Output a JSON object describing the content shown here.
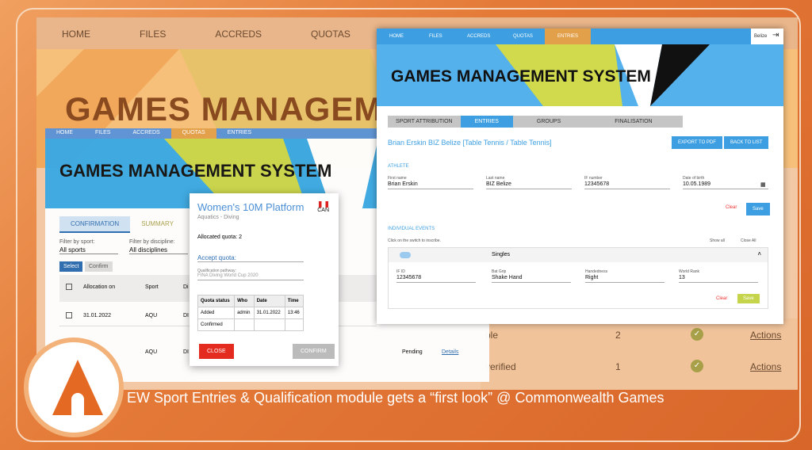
{
  "caption": "EW Sport Entries & Qualification module gets a “first look” @ Commonwealth Games",
  "win1": {
    "nav": [
      "HOME",
      "FILES",
      "ACCREDS",
      "QUOTAS"
    ],
    "title": "GAMES MANAGEMEN",
    "rows": [
      {
        "label": "ble",
        "count": "2",
        "action": "Actions"
      },
      {
        "label": "verified",
        "count": "1",
        "action": "Actions"
      }
    ]
  },
  "win2": {
    "nav": [
      "HOME",
      "FILES",
      "ACCREDS",
      "QUOTAS",
      "ENTRIES"
    ],
    "title": "GAMES MANAGEMENT SYSTEM",
    "tabs": [
      "CONFIRMATION",
      "SUMMARY"
    ],
    "filters": {
      "sport_label": "Filter by sport:",
      "sport_value": "All sports",
      "discipline_label": "Filter by discipline:",
      "discipline_value": "All disciplines"
    },
    "buttons": [
      "Select",
      "Confirm"
    ],
    "columns": [
      "Allocation on",
      "Sport",
      "Di"
    ],
    "rows": [
      {
        "date": "31.01.2022",
        "sport": "AQU",
        "code": "DI"
      },
      {
        "date": "",
        "sport": "AQU",
        "code": "DI",
        "status": "Pending",
        "link": "Details"
      }
    ]
  },
  "modal": {
    "title": "Women's 10M Platform",
    "subtitle": "Aquatics - Diving",
    "country": "CAN",
    "allocated": "Allocated quota: 2",
    "accept": "Accept quota:",
    "pathway_label": "Qualification pathway:",
    "pathway": "FINA Diving World Cup 2020",
    "table": {
      "headers": [
        "Quota status",
        "Who",
        "Date",
        "Time"
      ],
      "rows": [
        [
          "Added",
          "admin",
          "31.01.2022",
          "13:46"
        ],
        [
          "Confirmed",
          "",
          "",
          ""
        ]
      ]
    },
    "close": "CLOSE",
    "confirm": "CONFIRM"
  },
  "win3": {
    "nav": [
      "HOME",
      "FILES",
      "ACCREDS",
      "QUOTAS",
      "ENTRIES"
    ],
    "user": "Belize",
    "title": "GAMES MANAGEMENT SYSTEM",
    "tabs": [
      "SPORT ATTRIBUTION",
      "ENTRIES",
      "GROUPS",
      "FINALISATION"
    ],
    "heading": "Brian Erskin BIZ Belize [Table Tennis / Table Tennis]",
    "export": "EXPORT TO PDF",
    "back": "BACK TO LIST",
    "athlete_section": "ATHLETE",
    "fields": [
      {
        "label": "First name",
        "value": "Brian Erskin"
      },
      {
        "label": "Last name",
        "value": "BIZ Belize"
      },
      {
        "label": "IF number",
        "value": "12345678"
      },
      {
        "label": "Date of birth",
        "value": "10.05.1989"
      }
    ],
    "clear": "Clear",
    "save": "Save",
    "events_section": "INDIVIDUAL EVENTS",
    "hint": "Click on the switch to inscribe.",
    "show_all": "Show all",
    "close_all": "Close All",
    "event": "Singles",
    "event_fields": [
      {
        "label": "IF ID",
        "value": "12345678"
      },
      {
        "label": "Bat Grip",
        "value": "Shake Hand"
      },
      {
        "label": "Handedness",
        "value": "Right"
      },
      {
        "label": "World Rank",
        "value": "13"
      }
    ],
    "clear2": "Clear",
    "save2": "Save"
  }
}
